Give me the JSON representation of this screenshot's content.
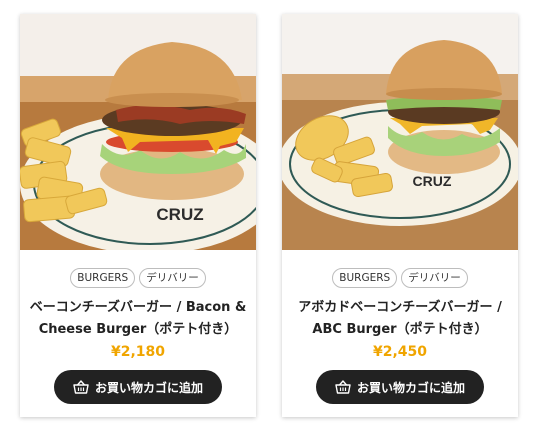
{
  "products": [
    {
      "tags": [
        "BURGERS",
        "デリバリー"
      ],
      "title_line1": "ベーコンチーズバーガー / Bacon &",
      "title_line2": "Cheese Burger（ポテト付き）",
      "price": "¥2,180",
      "cart_label": "お買い物カゴに追加",
      "plate_logo": "CRUZ"
    },
    {
      "tags": [
        "BURGERS",
        "デリバリー"
      ],
      "title_line1": "アボカドベーコンチーズバーガー /",
      "title_line2": "ABC Burger（ポテト付き）",
      "price": "¥2,450",
      "cart_label": "お買い物カゴに追加",
      "plate_logo": "CRUZ"
    }
  ],
  "colors": {
    "price": "#f0a500",
    "button_bg": "#222222",
    "button_text": "#ffffff"
  },
  "icons": {
    "cart": "basket-icon"
  }
}
